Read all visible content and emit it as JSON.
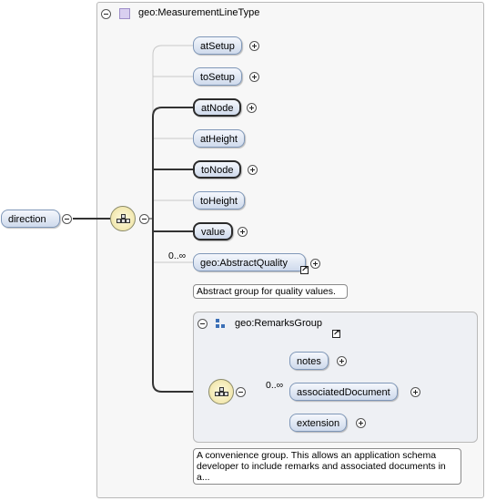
{
  "root_element": {
    "label": "direction"
  },
  "complex_type": {
    "label": "geo:MeasurementLineType"
  },
  "sequence_children": [
    {
      "label": "atSetup",
      "required": false,
      "expandable": true
    },
    {
      "label": "toSetup",
      "required": false,
      "expandable": true
    },
    {
      "label": "atNode",
      "required": true,
      "expandable": true
    },
    {
      "label": "atHeight",
      "required": false,
      "expandable": false
    },
    {
      "label": "toNode",
      "required": true,
      "expandable": true
    },
    {
      "label": "toHeight",
      "required": false,
      "expandable": false
    },
    {
      "label": "value",
      "required": true,
      "expandable": true
    }
  ],
  "abstract_quality": {
    "label": "geo:AbstractQuality",
    "cardinality": "0..∞",
    "note": "Abstract group for quality values."
  },
  "remarks_group": {
    "label": "geo:RemarksGroup",
    "children": [
      {
        "label": "notes",
        "cardinality": ""
      },
      {
        "label": "associatedDocument",
        "cardinality": "0..∞"
      },
      {
        "label": "extension",
        "cardinality": ""
      }
    ],
    "note": "A convenience group. This allows an application schema developer to include remarks and associated documents in a..."
  }
}
